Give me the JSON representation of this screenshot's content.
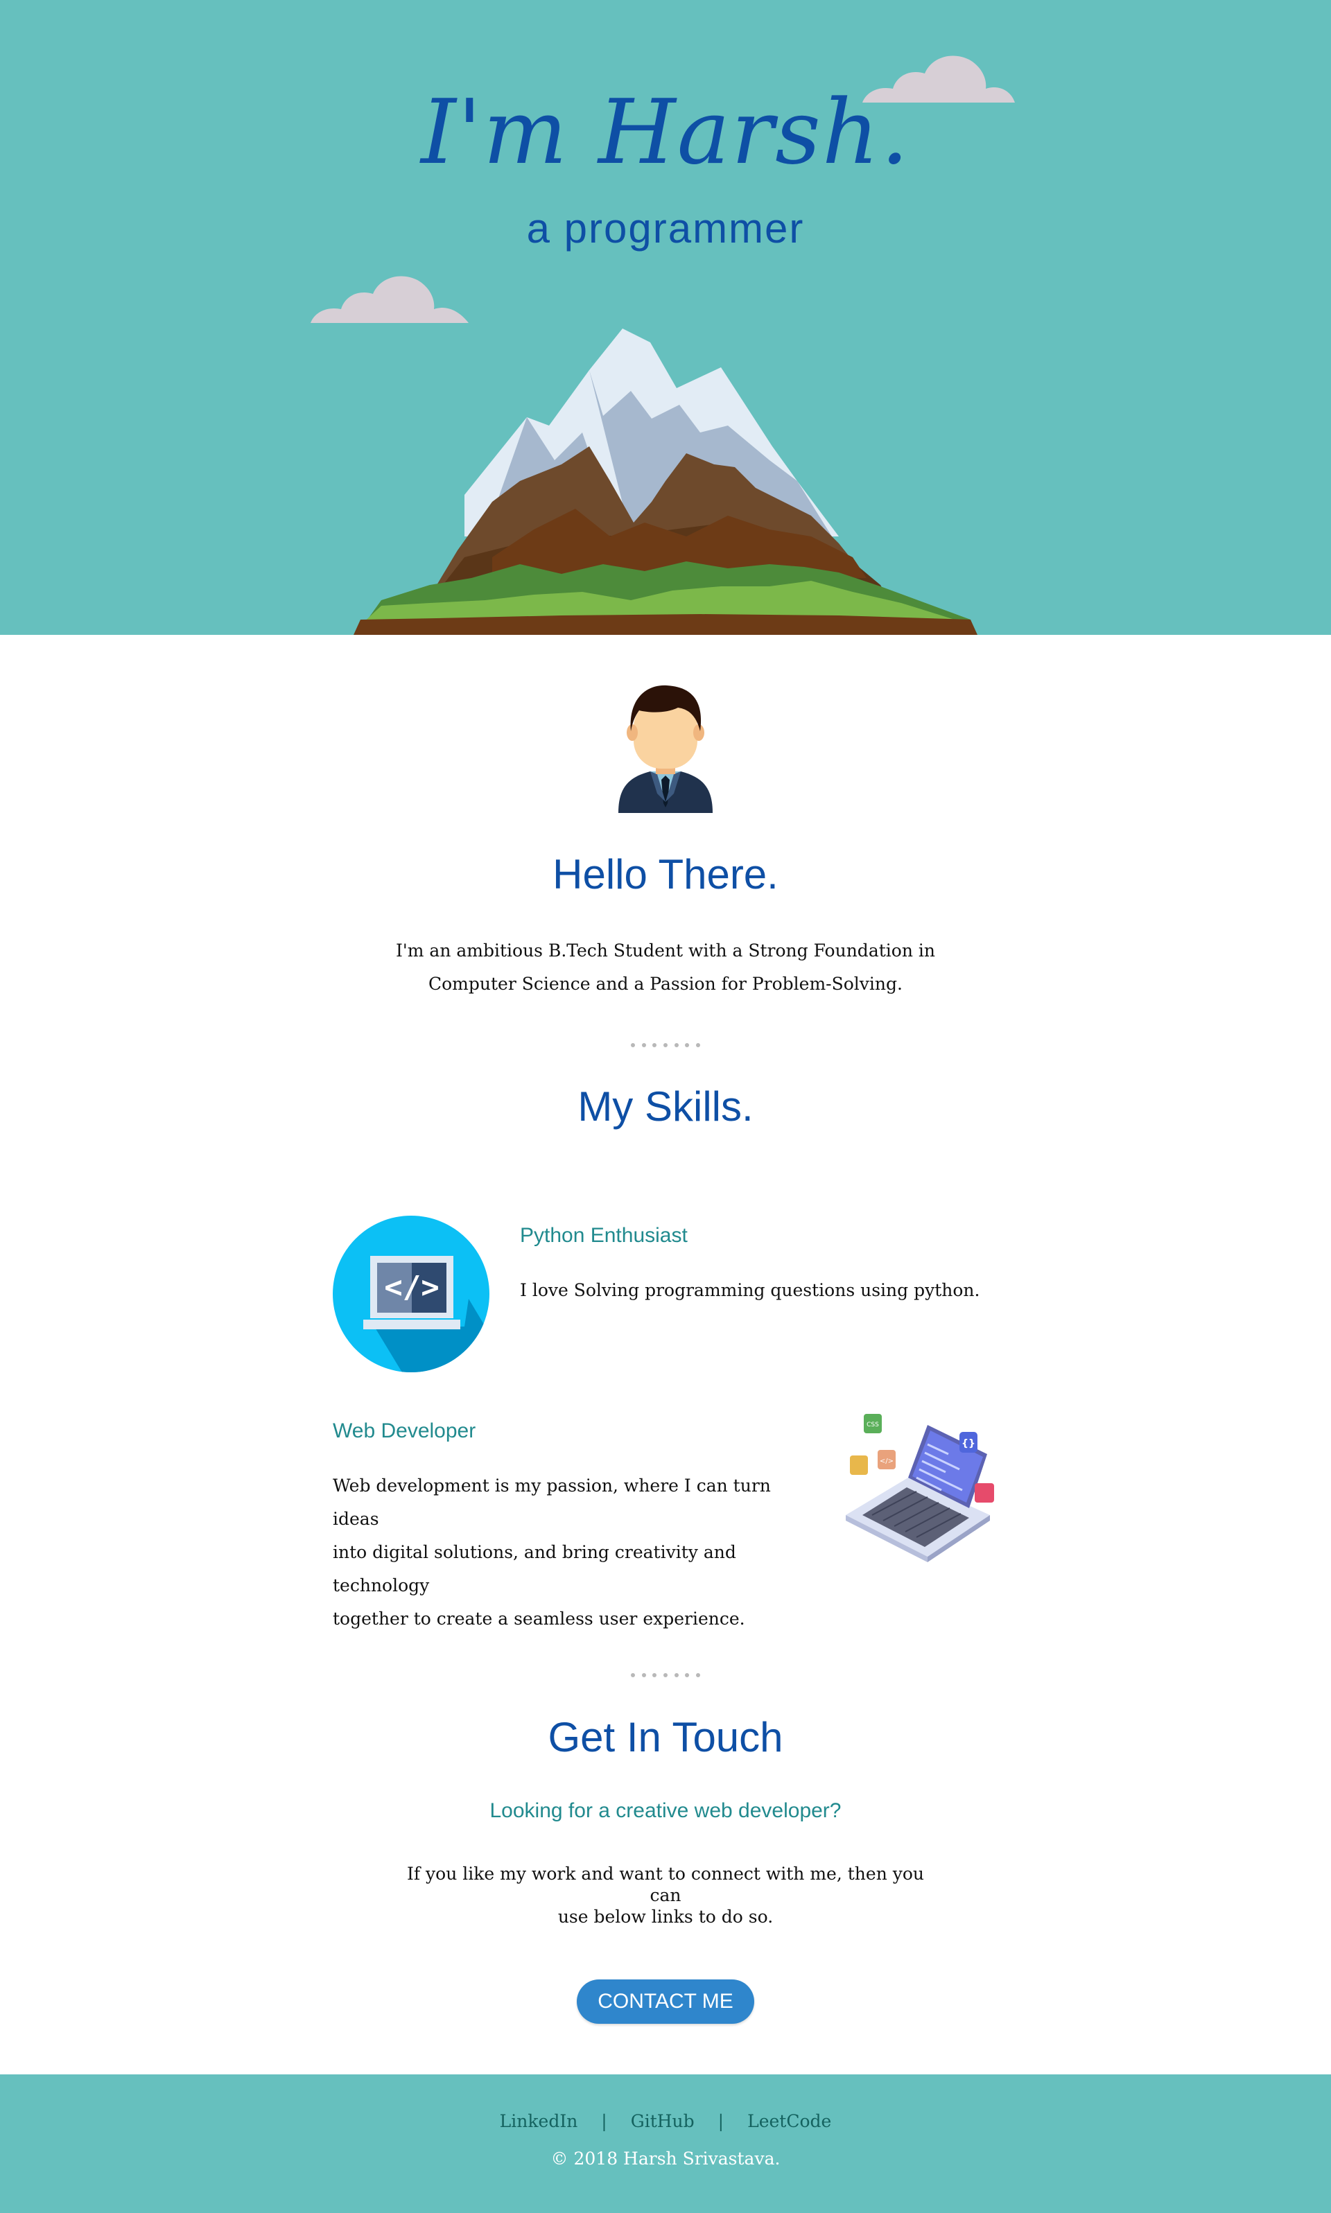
{
  "hero": {
    "title": "I'm Harsh.",
    "subtitle": "a programmer"
  },
  "about": {
    "title": "Hello There.",
    "text_line1": "I'm an ambitious B.Tech Student with a Strong Foundation in",
    "text_line2": "Computer Science and a Passion for Problem-Solving."
  },
  "skills": {
    "title": "My Skills.",
    "items": [
      {
        "title": "Python Enthusiast",
        "text": "I love Solving programming questions using python.",
        "icon": "code-laptop-icon"
      },
      {
        "title": "Web Developer",
        "text_line1": "Web development is my passion, where I can turn ideas",
        "text_line2": "into digital solutions, and bring creativity and technology",
        "text_line3": "together to create a seamless user experience.",
        "icon": "isometric-laptop-icon"
      }
    ]
  },
  "contact": {
    "title": "Get In Touch",
    "subtitle": "Looking for a creative web developer?",
    "text_line1": "If you like my work and want to connect with me, then you can",
    "text_line2": "use below links to do so.",
    "button_label": "CONTACT ME"
  },
  "footer": {
    "links": [
      "LinkedIn",
      "GitHub",
      "LeetCode"
    ],
    "separator": "|",
    "copyright": "© 2018 Harsh Srivastava."
  },
  "colors": {
    "teal": "#66c0be",
    "heading_blue": "#0e4fa5",
    "subheading_teal": "#218a8e",
    "button_blue": "#2f86cc"
  }
}
